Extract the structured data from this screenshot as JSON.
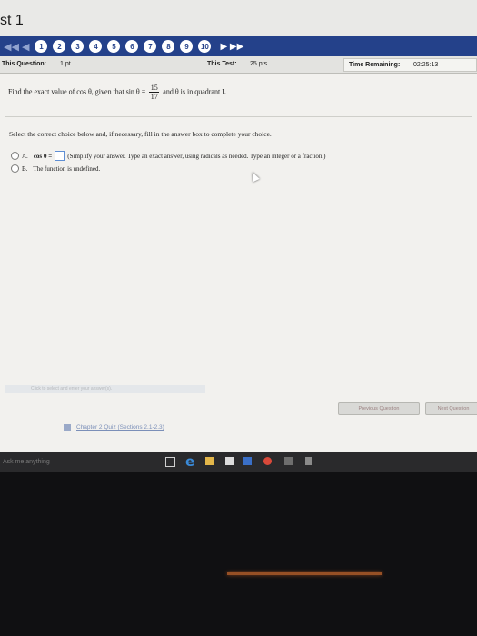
{
  "window": {
    "title": "st 1"
  },
  "nav": {
    "back_label": "◀◀ ◀",
    "questions": [
      "1",
      "2",
      "3",
      "4",
      "5",
      "6",
      "7",
      "8",
      "9",
      "10"
    ],
    "next_label": "▶ ▶▶"
  },
  "info": {
    "this_question_label": "This Question:",
    "this_question_value": "1 pt",
    "this_test_label": "This Test:",
    "this_test_value": "25 pts",
    "time_label": "Time Remaining:",
    "time_value": "02:25:13"
  },
  "question": {
    "prefix": "Find the exact value of cos θ, given that sin θ =",
    "numerator": "15",
    "denominator": "17",
    "suffix": "and θ is in quadrant I."
  },
  "instructions": "Select the correct choice below and, if necessary, fill in the answer box to complete your choice.",
  "choices": {
    "a_label": "A.",
    "a_prefix": "cos θ =",
    "a_hint": "(Simplify your answer. Type an exact answer, using radicals as needed. Type an integer or a fraction.)",
    "b_label": "B.",
    "b_text": "The function is undefined."
  },
  "hint_bar": "Click to select and enter your answer(s).",
  "buttons": {
    "previous": "Previous Question",
    "next": "Next Question"
  },
  "chapter_link": "Chapter 2 Quiz (Sections 2.1-2.3)",
  "taskbar": {
    "search_placeholder": "Ask me anything"
  },
  "colors": {
    "nav_bar": "#24418a",
    "link": "#7b8fb8",
    "answer_box_border": "#5f8fd4"
  }
}
